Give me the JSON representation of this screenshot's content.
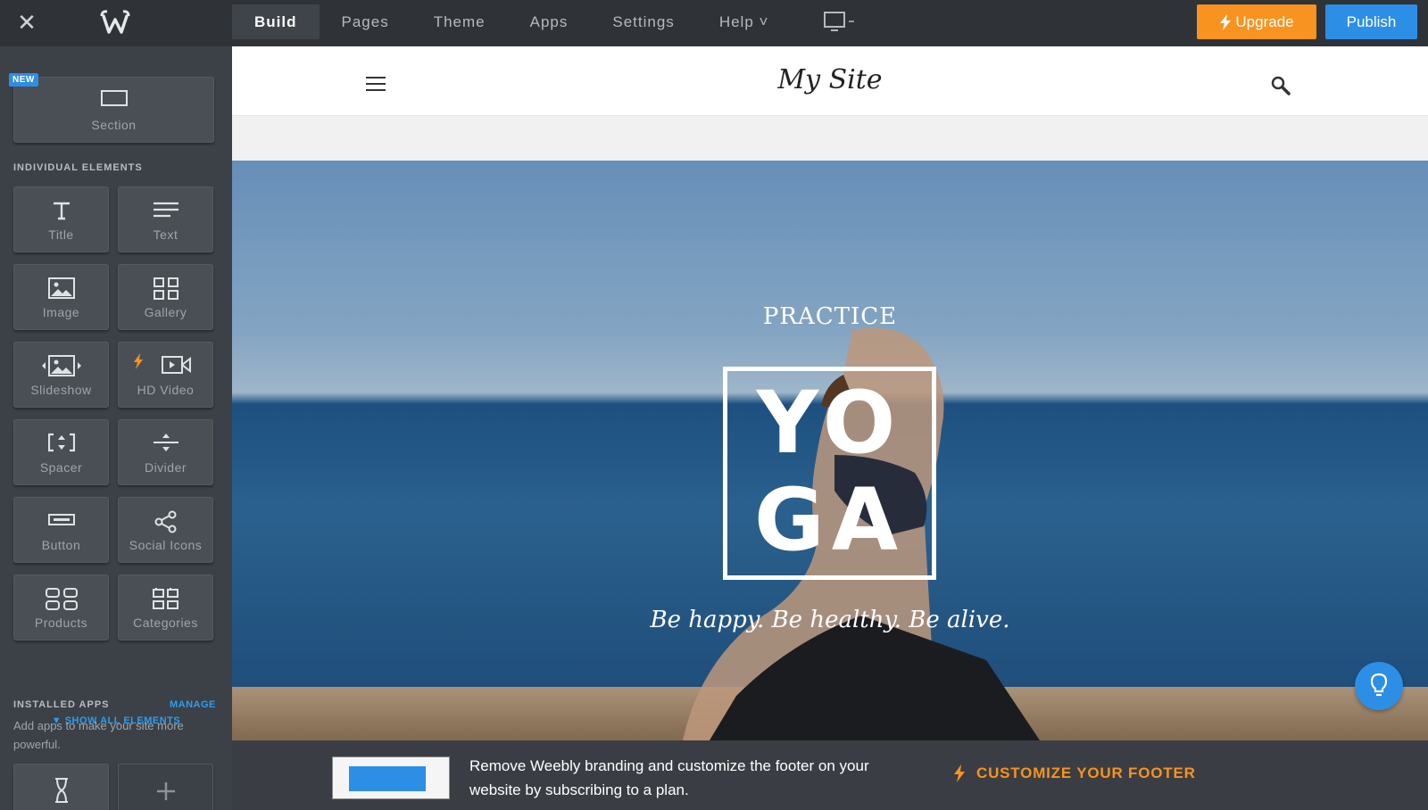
{
  "topbar": {
    "nav": [
      "Build",
      "Pages",
      "Theme",
      "Apps",
      "Settings",
      "Help ˅"
    ],
    "upgrade_label": "Upgrade",
    "publish_label": "Publish"
  },
  "sidebar": {
    "new_badge": "NEW",
    "section_label": "Section",
    "individual_heading": "INDIVIDUAL ELEMENTS",
    "elements": [
      "Title",
      "Text",
      "Image",
      "Gallery",
      "Slideshow",
      "HD Video",
      "Spacer",
      "Divider",
      "Button",
      "Social Icons",
      "Products",
      "Categories"
    ],
    "show_all": "SHOW ALL ELEMENTS",
    "installed_heading": "INSTALLED APPS",
    "manage": "MANAGE",
    "apps_desc": "Add apps to make your site more powerful."
  },
  "site": {
    "title": "My Site",
    "practice": "PRACTICE",
    "yoga_line1": "YO",
    "yoga_line2": "GA",
    "tagline": "Be happy. Be healthy. Be alive."
  },
  "footer": {
    "message": "Remove Weebly branding and customize the footer on your website by subscribing to a plan.",
    "cta": "CUSTOMIZE YOUR FOOTER"
  },
  "colors": {
    "upgrade": "#f7931e",
    "publish": "#2d8ee6",
    "sidebar_bg": "#3c4147"
  }
}
